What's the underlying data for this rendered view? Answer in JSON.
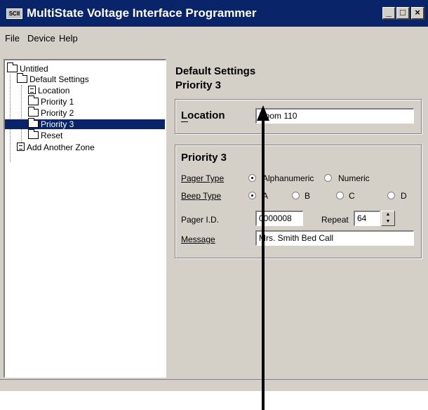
{
  "window": {
    "app_icon_text": "SCII",
    "title": "MultiState Voltage Interface Programmer",
    "buttons": {
      "minimize": "_",
      "maximize": "□",
      "close": "×"
    }
  },
  "menu": {
    "file": "File",
    "device": "Device",
    "help": "Help"
  },
  "tree": {
    "root": "Untitled",
    "default_settings": "Default Settings",
    "location": "Location",
    "priority1": "Priority 1",
    "priority2": "Priority 2",
    "priority3": "Priority 3",
    "reset": "Reset",
    "add_zone": "Add Another Zone",
    "selected": "Priority 3"
  },
  "header": {
    "line1": "Default Settings",
    "line2": "Priority 3"
  },
  "location": {
    "label": "Location",
    "value": "Room 110"
  },
  "priority": {
    "title": "Priority 3",
    "pager_type_label": "Pager Type",
    "pager_type_options": [
      "Alphanumeric",
      "Numeric"
    ],
    "pager_type_selected": "Alphanumeric",
    "beep_type_label": "Beep Type",
    "beep_type_options": [
      "A",
      "B",
      "C",
      "D"
    ],
    "beep_type_selected": "A",
    "pager_id_label": "Pager I.D.",
    "pager_id_value": "0000008",
    "repeat_label": "Repeat",
    "repeat_value": "64",
    "message_label": "Message",
    "message_value": "Mrs. Smith Bed Call"
  }
}
